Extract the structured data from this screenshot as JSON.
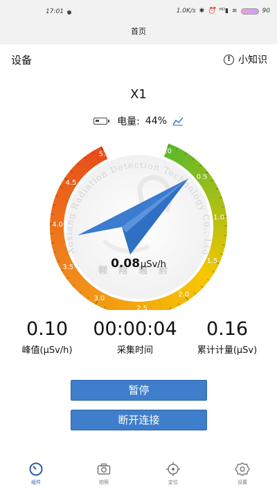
{
  "status_bar": {
    "time": "17:01",
    "network_speed": "1.0K/s",
    "indicators": [
      "bluetooth-icon",
      "alarm-icon",
      "hd-signal-icon",
      "wifi-icon",
      "battery-icon"
    ],
    "battery": "90"
  },
  "header": {
    "title": "首页"
  },
  "device": {
    "label": "设备",
    "tips_label": "小知识",
    "name": "X1"
  },
  "battery": {
    "label": "电量:",
    "value": "44%"
  },
  "gauge": {
    "ticks": [
      "0.0",
      "0.5",
      "1.0",
      "1.5",
      "2.0",
      "2.5",
      "3.0",
      "3.5",
      "4.0",
      "4.5",
      "5.0"
    ],
    "reading": "0.08",
    "unit": "μSv/h",
    "watermark_text": "Aoxiang Radiation Detection Technology Co., Ltd",
    "watermark_cn": "翱翔辐射",
    "colors": {
      "green": "#5cb82a",
      "yellow": "#f7c600",
      "orange": "#f08a1c",
      "red": "#e84a1a",
      "needle": "#3b7bd0"
    }
  },
  "stats": {
    "peak_value": "0.10",
    "peak_label": "峰值(μSv/h)",
    "time_value": "00:00:04",
    "time_label": "采集时间",
    "total_value": "0.16",
    "total_label": "累计计量(μSv)"
  },
  "buttons": {
    "pause": "暂停",
    "disconnect": "断开连接"
  },
  "nav": [
    {
      "label": "组件",
      "icon": "gauge-icon"
    },
    {
      "label": "拍照",
      "icon": "camera-icon"
    },
    {
      "label": "定位",
      "icon": "location-icon"
    },
    {
      "label": "设置",
      "icon": "settings-icon"
    }
  ]
}
